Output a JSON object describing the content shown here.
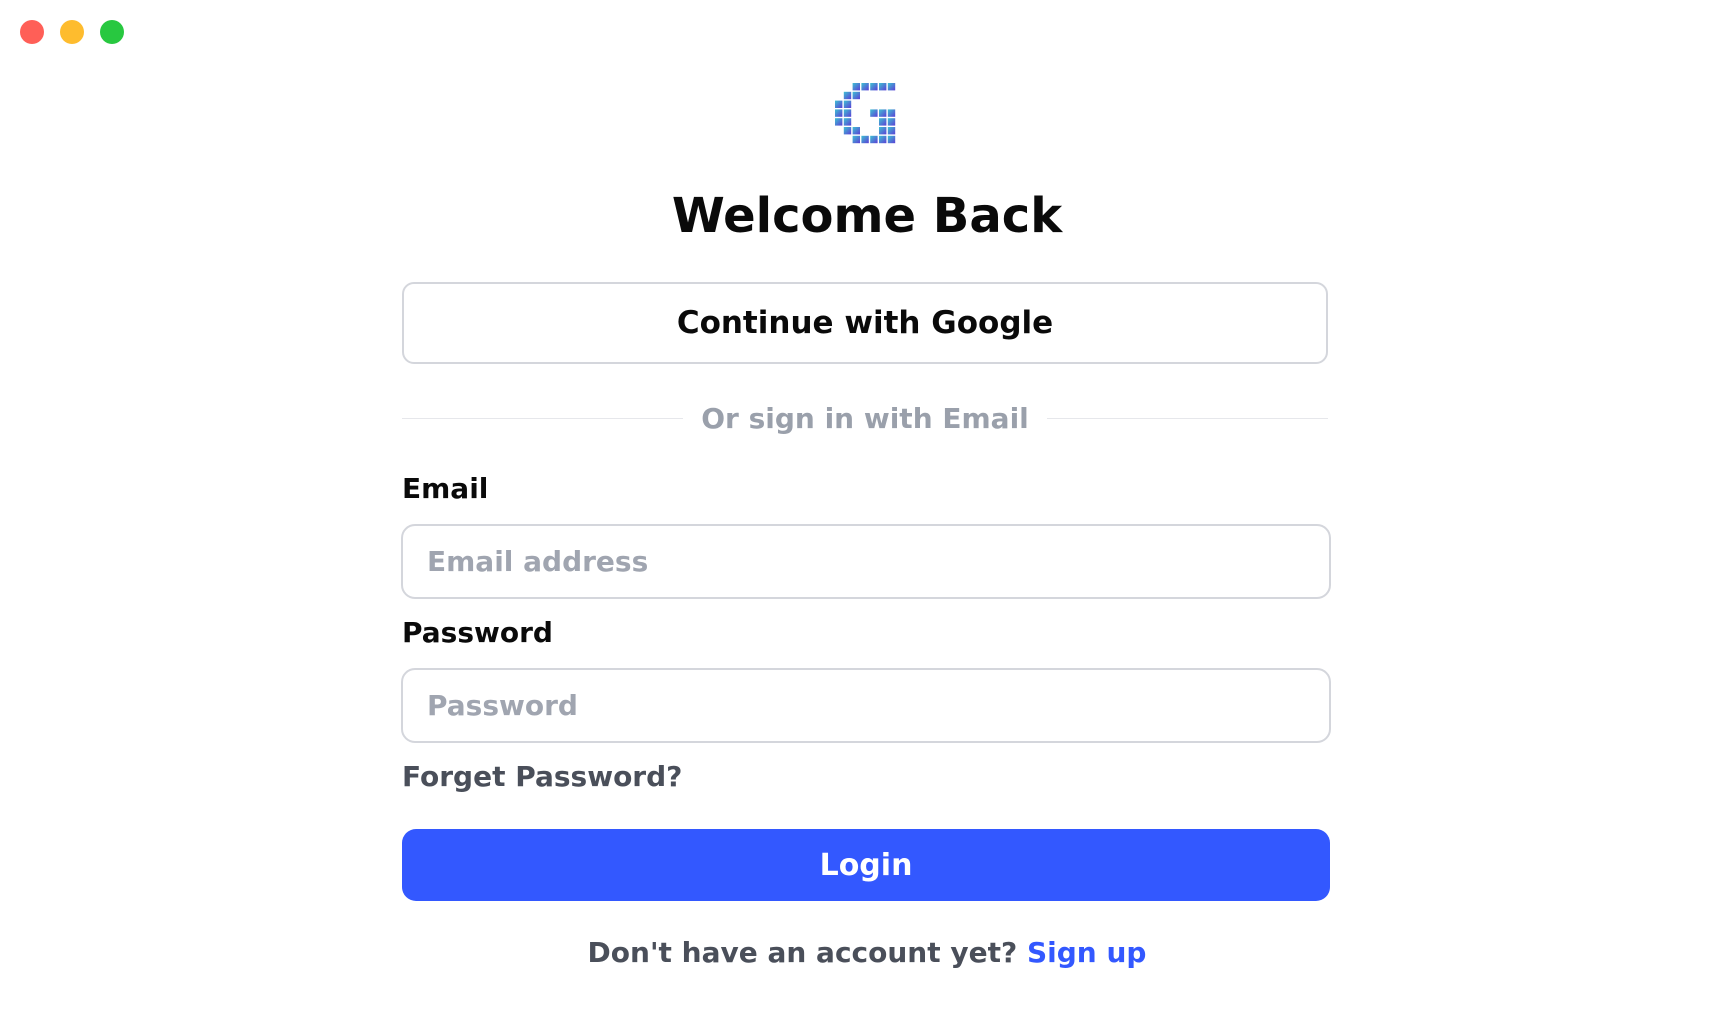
{
  "window": {
    "controls": [
      {
        "name": "close",
        "color": "#ff5f57"
      },
      {
        "name": "minimize",
        "color": "#febc2e"
      },
      {
        "name": "maximize",
        "color": "#28c840"
      }
    ]
  },
  "logo": {
    "icon": "pixel-g-logo-icon",
    "gradient_start": "#3ec1d3",
    "gradient_end": "#5b3fd6"
  },
  "heading": {
    "title": "Welcome Back"
  },
  "google": {
    "label": "Continue with Google"
  },
  "divider": {
    "text": "Or sign in with Email"
  },
  "form": {
    "email": {
      "label": "Email",
      "value": "",
      "placeholder": "Email address"
    },
    "password": {
      "label": "Password",
      "value": "",
      "placeholder": "Password"
    },
    "forgot_label": "Forget Password?",
    "login_label": "Login"
  },
  "signup": {
    "prompt": "Don't have an account yet?",
    "link_label": "Sign up"
  },
  "colors": {
    "accent": "#3358ff",
    "border": "#d4d6dc",
    "muted_text": "#9aa0ab"
  }
}
